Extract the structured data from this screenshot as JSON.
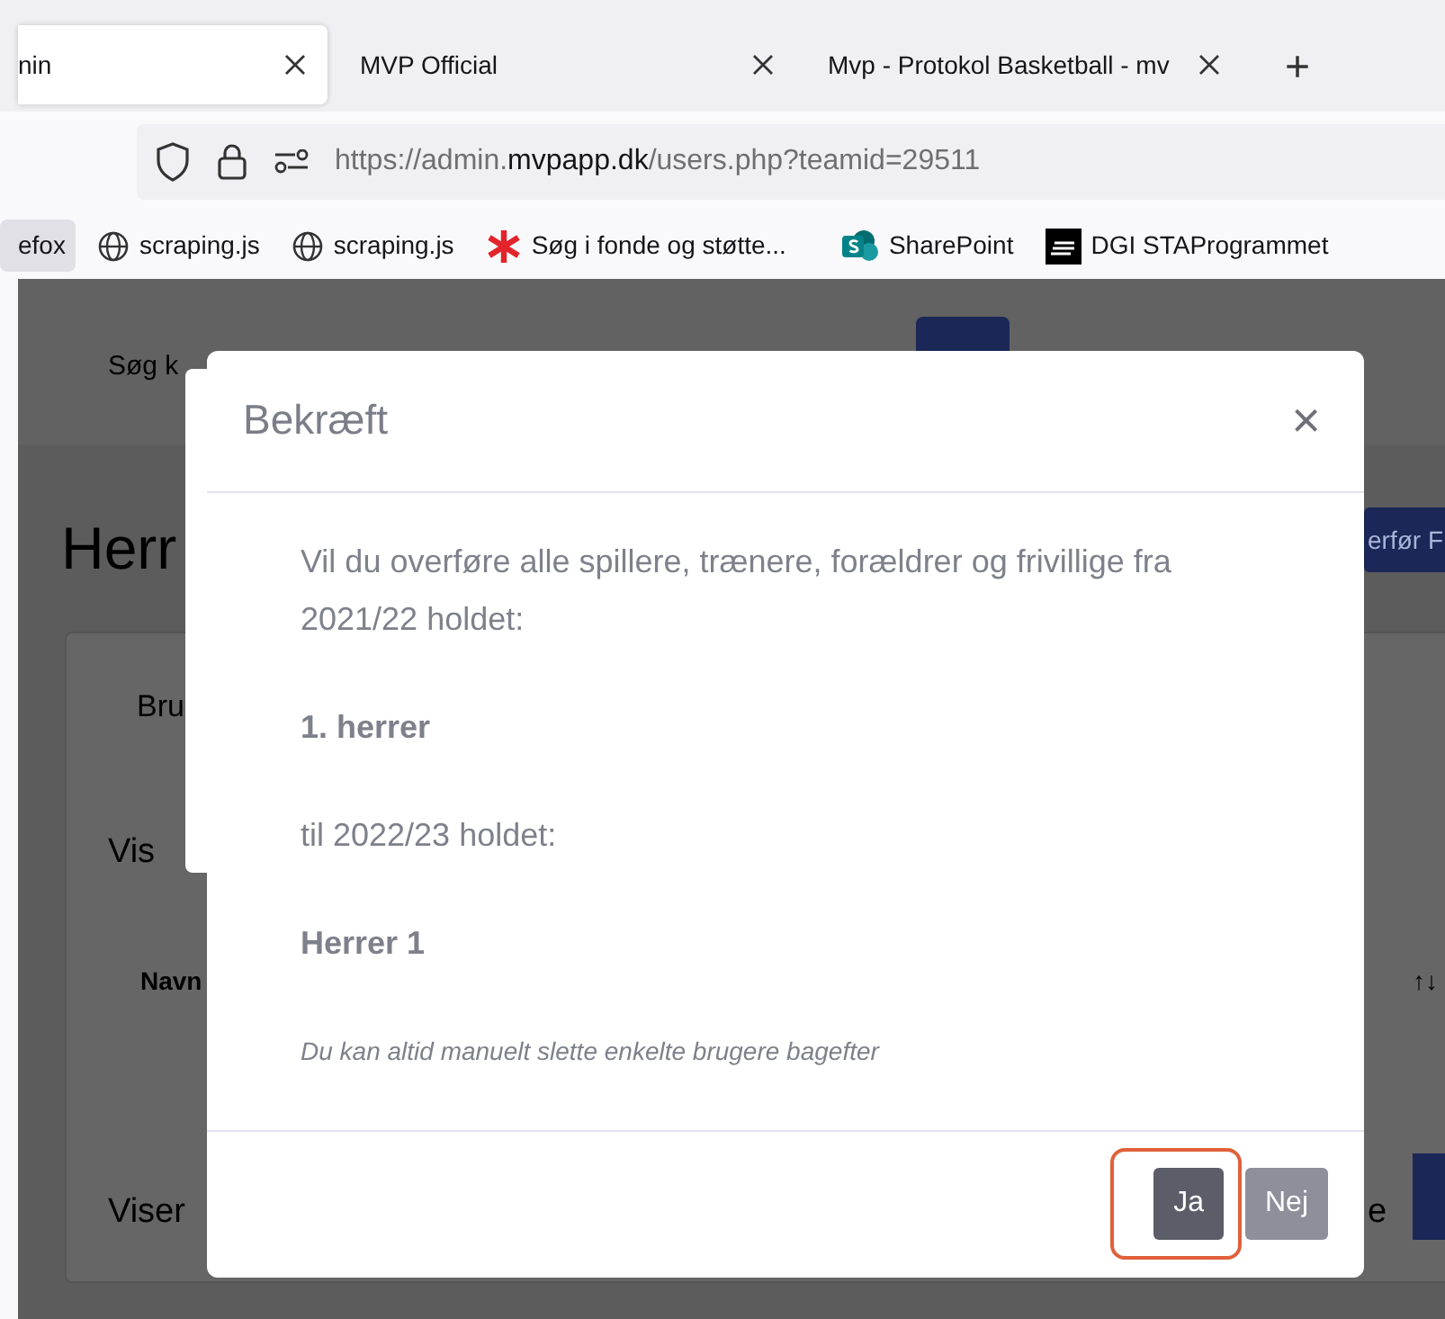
{
  "browser": {
    "tabs": [
      {
        "label": "nin",
        "selected": true
      },
      {
        "label": "MVP Official",
        "selected": false
      },
      {
        "label": "Mvp - Protokol Basketball - mv",
        "selected": false
      }
    ],
    "new_tab": "+",
    "address": {
      "prefix": "https://admin.",
      "domain": "mvpapp.dk",
      "path": "/users.php?teamid=29511"
    },
    "bookmarks": [
      {
        "label": "efox",
        "kind": "plain",
        "selected": true
      },
      {
        "label": "scraping.js",
        "kind": "globe",
        "selected": false
      },
      {
        "label": "scraping.js",
        "kind": "globe",
        "selected": false
      },
      {
        "label": "Søg i fonde og støtte...",
        "kind": "asterisk",
        "selected": false
      },
      {
        "label": "SharePoint",
        "kind": "sharepoint",
        "selected": false
      },
      {
        "label": "DGI STAProgrammet",
        "kind": "dgi",
        "selected": false
      }
    ]
  },
  "background_page": {
    "search_text": "Søg k",
    "heading": "Herr",
    "action_button": "erfør F",
    "tab": "Bru",
    "show_label": "Vis",
    "column_1": "Navn",
    "sort_mark": "↑↓",
    "footer_text": "Viser",
    "footer_right": "e"
  },
  "dialog": {
    "title": "Bekræft",
    "close": "×",
    "body": [
      {
        "text": "Vil du overføre alle spillere, trænere, forældrer og frivillige fra 2021/22 holdet:",
        "kind": "text"
      },
      {
        "text": "1. herrer",
        "kind": "bold"
      },
      {
        "text": "til 2022/23 holdet:",
        "kind": "text"
      },
      {
        "text": "Herrer 1",
        "kind": "bold"
      },
      {
        "text": "Du kan altid manuelt slette enkelte brugere bagefter",
        "kind": "note"
      }
    ],
    "buttons": [
      {
        "label": "Ja",
        "kind": "primary",
        "highlighted": true
      },
      {
        "label": "Nej",
        "kind": "secondary",
        "highlighted": false
      }
    ]
  }
}
